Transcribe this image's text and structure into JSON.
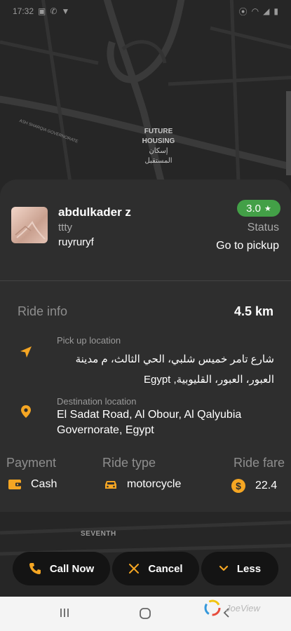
{
  "status_bar": {
    "time": "17:32",
    "left_icons": [
      "photo-icon",
      "call-icon",
      "signal-icon"
    ],
    "right_icons": [
      "location-icon",
      "wifi-icon",
      "signal-icon",
      "battery-icon"
    ]
  },
  "map": {
    "area_label": "FUTURE HOUSING",
    "area_label_ar": "إسكان المستقبل",
    "road_label": "ASH SHARQIA GOVERNORATE",
    "street_label": "SEVENTH"
  },
  "driver": {
    "name": "abdulkader z",
    "subtitle": "ttty",
    "plate": "ruyruryf",
    "rating": "3.0",
    "rating_icon": "star-icon"
  },
  "trip_status": {
    "label": "Status",
    "value": "Go to pickup"
  },
  "ride_info": {
    "label": "Ride info",
    "distance": "4.5 km",
    "pickup": {
      "caption": "Pick up location",
      "address": "شارع تامر خميس شلبي، الحي الثالث، م مدينة العبور، العبور، القليوبية, Egypt",
      "icon": "navigation-arrow-icon"
    },
    "destination": {
      "caption": "Destination location",
      "address": "El Sadat Road, Al Obour, Al Qalyubia Governorate, Egypt",
      "icon": "location-pin-icon"
    }
  },
  "summary": {
    "payment_label": "Payment",
    "payment_value": "Cash",
    "ride_type_label": "Ride type",
    "ride_type_value": "motorcycle",
    "fare_label": "Ride fare",
    "fare_value": "22.4"
  },
  "actions": {
    "call": "Call Now",
    "cancel": "Cancel",
    "less": "Less"
  },
  "watermark": "JoeView",
  "colors": {
    "accent": "#f5a623",
    "rating_bg": "#43a047",
    "sheet_bg": "#2e2e2e",
    "button_bg": "#141414",
    "map_bg": "#262626"
  }
}
